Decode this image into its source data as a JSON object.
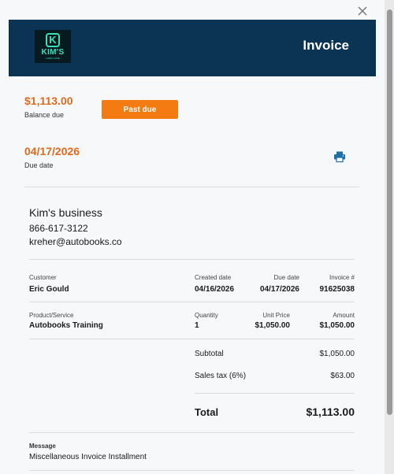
{
  "header": {
    "title": "Invoice",
    "logo_name": "KIM'S",
    "logo_letter": "K",
    "logo_sub": "LAWN CARE"
  },
  "summary": {
    "balance_amount": "$1,113.00",
    "balance_label": "Balance due",
    "status_button": "Past due",
    "due_date": "04/17/2026",
    "due_date_label": "Due date"
  },
  "business": {
    "name": "Kim's business",
    "phone": "866-617-3122",
    "email": "kreher@autobooks.co"
  },
  "details": {
    "customer_label": "Customer",
    "customer_value": "Eric Gould",
    "created_label": "Created date",
    "created_value": "04/16/2026",
    "due_label": "Due date",
    "due_value": "04/17/2026",
    "invoice_label": "Invoice #",
    "invoice_value": "91625038"
  },
  "line_item": {
    "product_label": "Product/Service",
    "product_value": "Autobooks Training",
    "quantity_label": "Quantity",
    "quantity_value": "1",
    "unit_price_label": "Unit Price",
    "unit_price_value": "$1,050.00",
    "amount_label": "Amount",
    "amount_value": "$1,050.00"
  },
  "totals": {
    "subtotal_label": "Subtotal",
    "subtotal_value": "$1,050.00",
    "tax_label": "Sales tax (6%)",
    "tax_value": "$63.00",
    "total_label": "Total",
    "total_value": "$1,113.00"
  },
  "message": {
    "label": "Message",
    "text": "Miscellaneous Invoice Installment"
  },
  "colors": {
    "header_bg": "#0b3354",
    "accent_orange": "#e06a1c",
    "button_orange": "#f47a12",
    "print_icon": "#1f6fa8"
  },
  "icons": {
    "close": "close-icon",
    "print": "printer-icon"
  }
}
